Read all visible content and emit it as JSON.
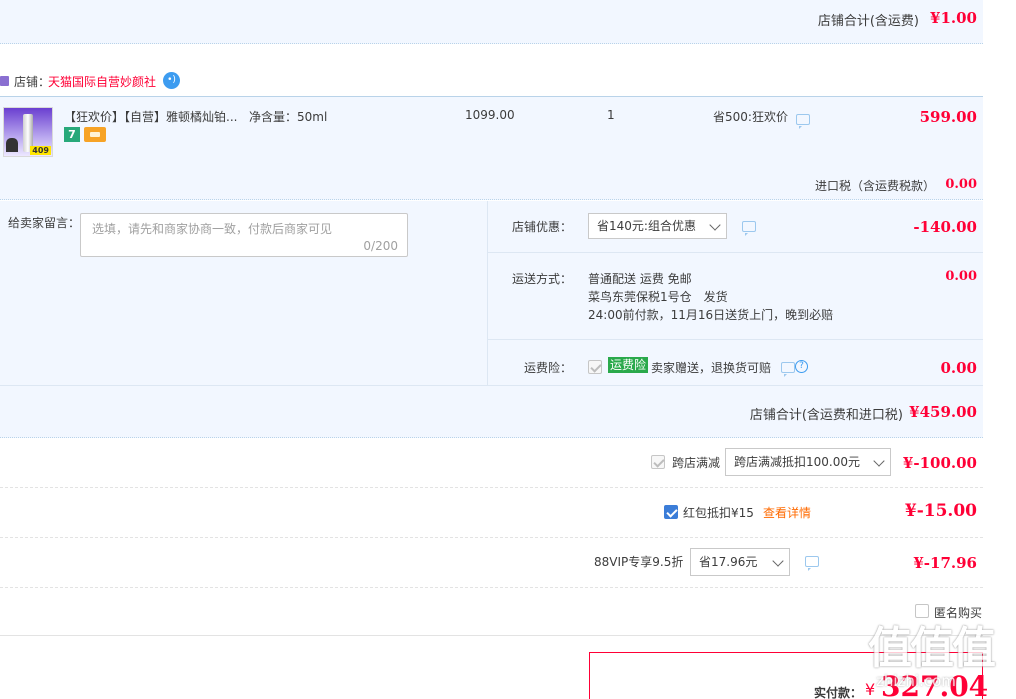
{
  "top_total": {
    "label": "店铺合计(含运费)",
    "value": "¥1.00"
  },
  "shop": {
    "label": "店铺：",
    "name": "天猫国际自营妙颜社"
  },
  "item": {
    "title": "【狂欢价】【自营】雅顿橘灿铂...",
    "spec": "净含量：50ml",
    "original_price": "1099.00",
    "quantity": "1",
    "promo": "省500:狂欢价",
    "price": "599.00",
    "thumb_badge": "409",
    "badge_seven": "7"
  },
  "tax": {
    "label": "进口税（含运费税款）",
    "value": "0.00"
  },
  "message": {
    "label": "给卖家留言：",
    "placeholder": "选填，请先和商家协商一致，付款后商家可见",
    "counter": "0/200"
  },
  "discount": {
    "label": "店铺优惠：",
    "selected": "省140元:组合优惠",
    "value": "-140.00"
  },
  "shipping": {
    "label": "运送方式：",
    "line1": "普通配送 运费 免邮",
    "line2": "菜鸟东莞保税1号仓　发货",
    "line3": "24:00前付款，11月16日送货上门，晚到必赔",
    "value": "0.00"
  },
  "insurance": {
    "label": "运费险：",
    "tag": "运费险",
    "text": "卖家赠送，退换货可赔",
    "value": "0.00"
  },
  "shop_total": {
    "label": "店铺合计(含运费和进口税)",
    "value": "¥459.00"
  },
  "cross_store": {
    "label": "跨店满减",
    "selected": "跨店满减抵扣100.00元",
    "value": "¥-100.00"
  },
  "red_packet": {
    "label": "红包抵扣¥15",
    "link": "查看详情",
    "value": "¥-15.00"
  },
  "vip": {
    "label": "88VIP专享9.5折",
    "selected": "省17.96元",
    "value": "¥-17.96"
  },
  "anonymous": {
    "label": "匿名购买"
  },
  "pay": {
    "label": "实付款：",
    "currency": "¥",
    "amount": "327.04"
  },
  "watermark": {
    "text": "值值值",
    "sub": "zhizhi.com"
  },
  "colors": {
    "accent": "#ff0036",
    "band": "#f2f7ff",
    "link": "#ff6a00"
  }
}
